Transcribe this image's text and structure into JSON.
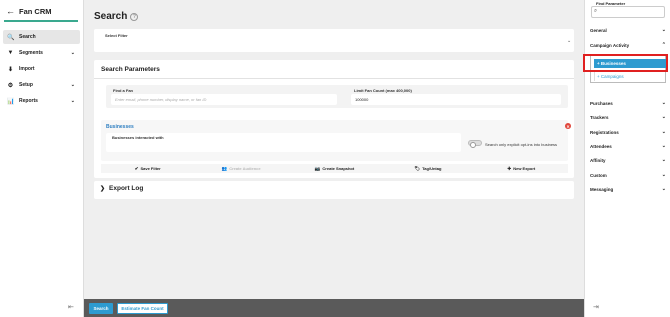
{
  "app": {
    "title": "Fan CRM",
    "back_icon": "arrow-left-icon"
  },
  "sidebar": {
    "items": [
      {
        "label": "Search",
        "icon": "search-icon",
        "glyph": "🔍",
        "active": true,
        "chevron": false
      },
      {
        "label": "Segments",
        "icon": "filter-icon",
        "glyph": "▼",
        "active": false,
        "chevron": true
      },
      {
        "label": "Import",
        "icon": "import-icon",
        "glyph": "⬇",
        "active": false,
        "chevron": false
      },
      {
        "label": "Setup",
        "icon": "setup-icon",
        "glyph": "⚙",
        "active": false,
        "chevron": true
      },
      {
        "label": "Reports",
        "icon": "chart-icon",
        "glyph": "📊",
        "active": false,
        "chevron": true
      }
    ],
    "collapse_glyph": "⇤"
  },
  "main": {
    "title": "Search",
    "help_glyph": "?",
    "select_filter": {
      "label": "Select Filter"
    },
    "params": {
      "title": "Search Parameters",
      "find_fan": {
        "label": "Find a Fan",
        "placeholder": "Enter email, phone number, display name, or fan ID"
      },
      "limit": {
        "label": "Limit Fan Count (max 400,000)",
        "value": "100000"
      },
      "businesses": {
        "title": "Businesses",
        "interacted_label": "Businesses interacted with",
        "optin_label": "Search only explicit opt-ins into business"
      },
      "actions": [
        {
          "label": "Save Filter",
          "glyph": "✔",
          "disabled": false
        },
        {
          "label": "Create Audience",
          "glyph": "👥",
          "disabled": true
        },
        {
          "label": "Create Snapshot",
          "glyph": "📷",
          "disabled": false
        },
        {
          "label": "Tag/Untag",
          "glyph": "🏷",
          "disabled": false
        },
        {
          "label": "New Export",
          "glyph": "✚",
          "disabled": false
        }
      ]
    },
    "export_log": {
      "title": "Export Log"
    },
    "bottom": {
      "search_label": "Search",
      "estimate_label": "Estimate Fan Count"
    }
  },
  "right_panel": {
    "find_parameter_label": "Find Parameter",
    "items": [
      {
        "label": "General",
        "chevron": "⌄"
      },
      {
        "label": "Campaign Activity",
        "chevron": "⌃"
      }
    ],
    "sub_items": {
      "active": "+ Businesses",
      "other": "+ Campaigns"
    },
    "more_items": [
      {
        "label": "Purchases"
      },
      {
        "label": "Trackers"
      },
      {
        "label": "Registrations"
      },
      {
        "label": "Attendees"
      },
      {
        "label": "Affinity"
      },
      {
        "label": "Custom"
      },
      {
        "label": "Messaging"
      }
    ],
    "collapse_glyph": "⇥"
  },
  "colors": {
    "accent": "#2d9bd0",
    "brand_rule": "#3aa98f",
    "highlight": "#e02020",
    "remove": "#e0453a"
  }
}
